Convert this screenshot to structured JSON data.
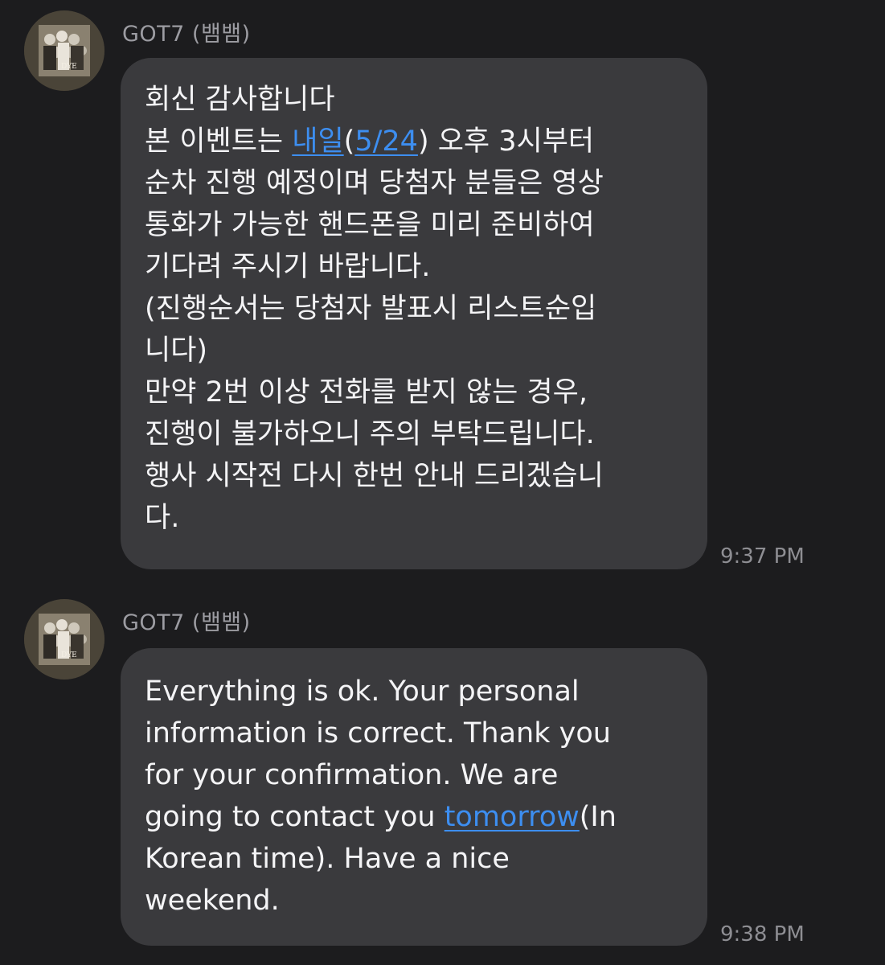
{
  "messages": [
    {
      "sender": "GOT7 (뱀뱀)",
      "time": "9:37 PM",
      "lines": {
        "l1": "회신 감사합니다",
        "l2a": "본 이벤트는 ",
        "l2link1": "내일",
        "l2b": "(",
        "l2link2": "5/24",
        "l2c": ") 오후 3시부터",
        "l3": "순차 진행 예정이며 당첨자 분들은 영상",
        "l4": "통화가 가능한 핸드폰을 미리 준비하여",
        "l5": "기다려 주시기 바랍니다.",
        "l6": "(진행순서는 당첨자 발표시 리스트순입",
        "l7": "니다)",
        "l8": "만약 2번 이상 전화를 받지 않는 경우,",
        "l9": "진행이 불가하오니 주의 부탁드립니다.",
        "l10": "행사 시작전 다시 한번 안내 드리겠습니",
        "l11": "다."
      }
    },
    {
      "sender": "GOT7 (뱀뱀)",
      "time": "9:38 PM",
      "lines": {
        "l1": "Everything is ok. Your personal",
        "l2": "information is correct. Thank you",
        "l3": "for your confirmation. We are",
        "l4a": "going to contact you ",
        "l4link": "tomorrow",
        "l4b": "(In",
        "l5": "Korean time). Have a nice",
        "l6": "weekend."
      }
    }
  ],
  "colors": {
    "background": "#1c1c1e",
    "bubble": "#3a3a3d",
    "link": "#3d8ef0",
    "sender": "#9c9ca2",
    "timestamp": "#8e8e93"
  },
  "icons": {
    "avatar": "group-photo-avatar"
  }
}
